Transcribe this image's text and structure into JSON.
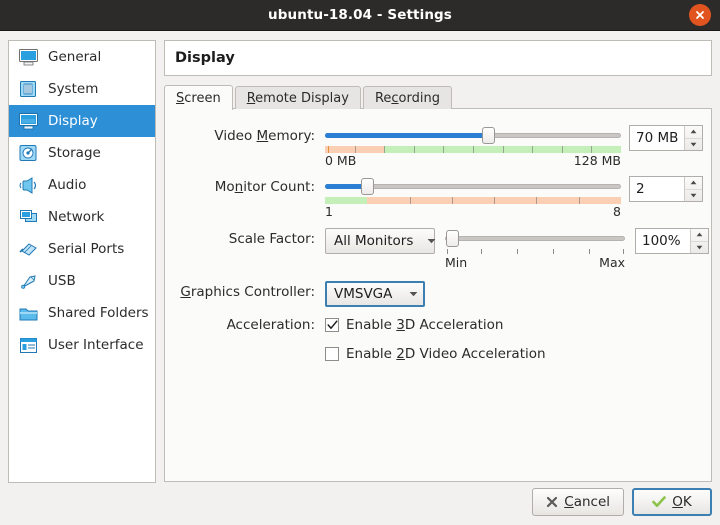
{
  "window": {
    "title": "ubuntu-18.04 - Settings",
    "close_icon": "close-icon",
    "accent_orange": "#e2541f",
    "selection_blue": "#2d8fd5"
  },
  "sidebar": {
    "items": [
      {
        "label": "General",
        "icon": "monitor-icon",
        "selected": false
      },
      {
        "label": "System",
        "icon": "chip-icon",
        "selected": false
      },
      {
        "label": "Display",
        "icon": "display-icon",
        "selected": true
      },
      {
        "label": "Storage",
        "icon": "harddisk-icon",
        "selected": false
      },
      {
        "label": "Audio",
        "icon": "speaker-icon",
        "selected": false
      },
      {
        "label": "Network",
        "icon": "network-icon",
        "selected": false
      },
      {
        "label": "Serial Ports",
        "icon": "serial-port-icon",
        "selected": false
      },
      {
        "label": "USB",
        "icon": "usb-icon",
        "selected": false
      },
      {
        "label": "Shared Folders",
        "icon": "folder-icon",
        "selected": false
      },
      {
        "label": "User Interface",
        "icon": "window-icon",
        "selected": false
      }
    ]
  },
  "page": {
    "title": "Display",
    "tabs": [
      {
        "label": "Screen",
        "mnemonic": "S",
        "active": true
      },
      {
        "label": "Remote Display",
        "mnemonic": "R",
        "active": false
      },
      {
        "label": "Recording",
        "mnemonic": "c",
        "active": false
      }
    ]
  },
  "form": {
    "video_memory": {
      "label_pre": "Video ",
      "label_mnemonic": "M",
      "label_post": "emory:",
      "min_label": "0 MB",
      "max_label": "128 MB",
      "value_text": "70 MB",
      "value": 70,
      "min": 0,
      "max": 128,
      "warn_upto": 26,
      "warn_color": "#fbcfb3",
      "ok_color": "#c5efb9"
    },
    "monitor_count": {
      "label_pre": "Mo",
      "label_mnemonic": "n",
      "label_post": "itor Count:",
      "min_label": "1",
      "max_label": "8",
      "value_text": "2",
      "value": 2,
      "min": 1,
      "max": 8,
      "ok_upto": 2,
      "ok_color": "#c5efb9",
      "warn_color": "#fbcfb3"
    },
    "scale_factor": {
      "label": "Scale Factor:",
      "combo_value": "All Monitors",
      "min_label": "Min",
      "max_label": "Max",
      "value_text": "100%",
      "value": 100,
      "min": 100,
      "max": 200
    },
    "graphics_controller": {
      "label_pre": "",
      "label_mnemonic": "G",
      "label_post": "raphics Controller:",
      "combo_value": "VMSVGA"
    },
    "acceleration": {
      "label": "Acceleration:",
      "options": [
        {
          "label_pre": "Enable ",
          "mnemonic": "3",
          "label_post": "D Acceleration",
          "checked": true
        },
        {
          "label_pre": "Enable ",
          "mnemonic": "2",
          "label_post": "D Video Acceleration",
          "checked": false
        }
      ]
    }
  },
  "footer": {
    "cancel": {
      "label_pre": "",
      "mnemonic": "C",
      "label_post": "ancel",
      "icon": "cross-icon"
    },
    "ok": {
      "label_pre": "",
      "mnemonic": "O",
      "label_post": "K",
      "icon": "check-icon"
    }
  }
}
